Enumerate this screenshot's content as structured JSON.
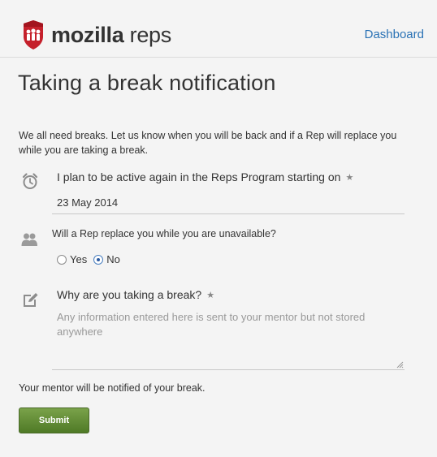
{
  "header": {
    "brand_bold": "mozilla",
    "brand_light": " reps",
    "nav_link": "Dashboard"
  },
  "page": {
    "title": "Taking a break notification",
    "intro": "We all need breaks. Let us know when you will be back and if a Rep will replace you while you are taking a break."
  },
  "form": {
    "date_label": "I plan to be active again in the Reps Program starting on",
    "required_mark": "★",
    "date_value": "23 May 2014",
    "replace_label": "Will a Rep replace you while you are unavailable?",
    "replace_options": [
      {
        "label": "Yes",
        "checked": false
      },
      {
        "label": "No",
        "checked": true
      }
    ],
    "why_label": "Why are you taking a break?",
    "why_placeholder": "Any information entered here is sent to your mentor but not stored anywhere",
    "notice": "Your mentor will be notified of your break.",
    "submit_label": "Submit"
  },
  "icons": {
    "logo": "mozilla-reps-shield-icon",
    "date": "alarm-clock-icon",
    "replace": "people-icon",
    "why": "edit-icon"
  },
  "colors": {
    "link": "#2a72b5",
    "logo_red": "#c5202b",
    "submit_green": "#5f8a32"
  }
}
